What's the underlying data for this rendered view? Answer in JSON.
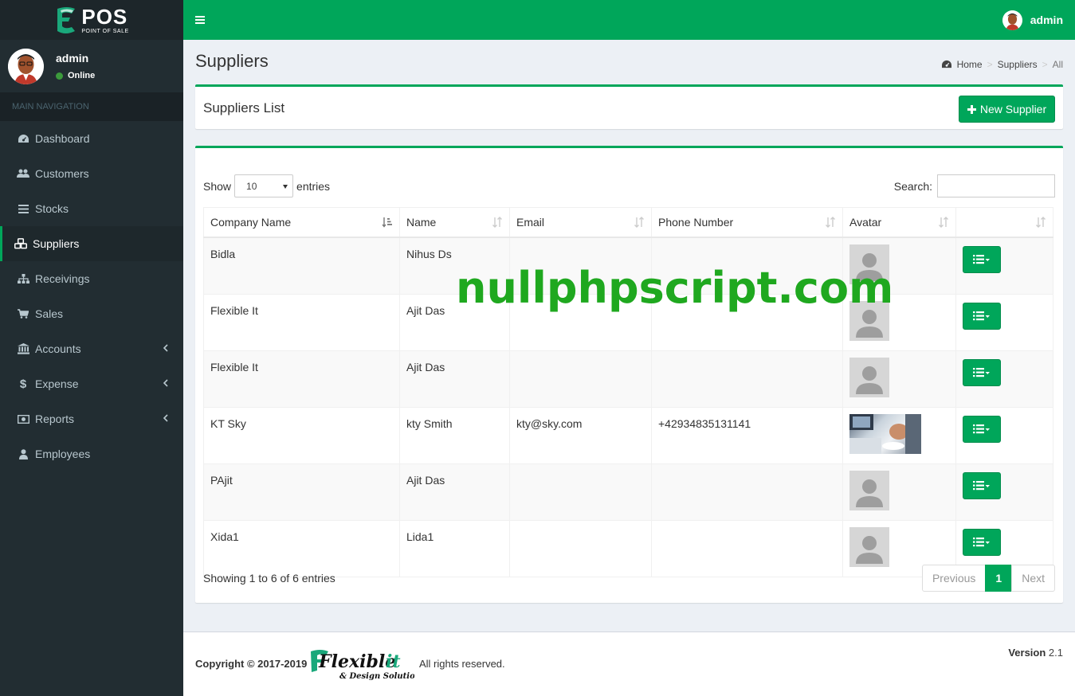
{
  "brand": {
    "title": "POS",
    "subtitle": "POINT OF SALE"
  },
  "user": {
    "name": "admin",
    "status": "Online"
  },
  "sidebar": {
    "header": "MAIN NAVIGATION",
    "items": [
      {
        "label": "Dashboard",
        "icon": "dashboard-icon"
      },
      {
        "label": "Customers",
        "icon": "users-icon"
      },
      {
        "label": "Stocks",
        "icon": "list-icon"
      },
      {
        "label": "Suppliers",
        "icon": "cubes-icon",
        "active": true
      },
      {
        "label": "Receivings",
        "icon": "sitemap-icon"
      },
      {
        "label": "Sales",
        "icon": "cart-icon"
      },
      {
        "label": "Accounts",
        "icon": "bank-icon",
        "has_submenu": true
      },
      {
        "label": "Expense",
        "icon": "dollar-icon",
        "has_submenu": true
      },
      {
        "label": "Reports",
        "icon": "money-icon",
        "has_submenu": true
      },
      {
        "label": "Employees",
        "icon": "user-icon"
      }
    ]
  },
  "topbar": {
    "user_name": "admin"
  },
  "page": {
    "title": "Suppliers",
    "breadcrumb": {
      "home": "Home",
      "section": "Suppliers",
      "current": "All"
    }
  },
  "list_box": {
    "title": "Suppliers List",
    "new_button": "New Supplier"
  },
  "table": {
    "show_label": "Show",
    "entries_label": "entries",
    "page_length": "10",
    "search_label": "Search:",
    "search_value": "",
    "columns": [
      "Company Name",
      "Name",
      "Email",
      "Phone Number",
      "Avatar",
      ""
    ],
    "rows": [
      {
        "company": "Bidla",
        "name": "Nihus Ds",
        "email": "",
        "phone": "",
        "avatar": "default"
      },
      {
        "company": "Flexible It",
        "name": "Ajit Das",
        "email": "",
        "phone": "",
        "avatar": "default"
      },
      {
        "company": "Flexible It",
        "name": "Ajit Das",
        "email": "",
        "phone": "",
        "avatar": "default"
      },
      {
        "company": "KT Sky",
        "name": "kty Smith",
        "email": "kty@sky.com",
        "phone": "+42934835131141",
        "avatar": "photo"
      },
      {
        "company": "PAjit",
        "name": "Ajit Das",
        "email": "",
        "phone": "",
        "avatar": "default"
      },
      {
        "company": "Xida1",
        "name": "Lida1",
        "email": "",
        "phone": "",
        "avatar": "default"
      }
    ],
    "info": "Showing 1 to 6 of 6 entries",
    "pagination": {
      "previous": "Previous",
      "current": "1",
      "next": "Next"
    }
  },
  "watermark": "nullphpscript.com",
  "footer": {
    "copyright": "Copyright © 2017-2019",
    "logo_text": "Flexible it",
    "logo_sub": "& Design Solution",
    "rights": "All rights reserved.",
    "version_label": "Version",
    "version_number": "2.1"
  },
  "colors": {
    "accent": "#00a65a",
    "sidebar": "#222d32",
    "background": "#ecf0f5"
  }
}
